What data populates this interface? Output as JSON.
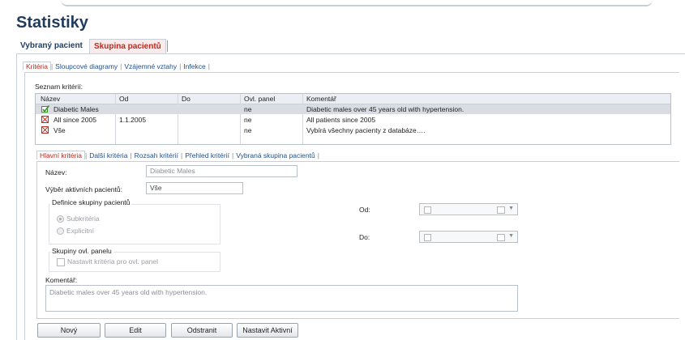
{
  "page_title": "Statistiky",
  "main_tabs": [
    "Vybraný pacient",
    "Skupina pacientů"
  ],
  "sub_tabs": [
    "Kritéria",
    "Sloupcové diagramy",
    "Vzájemné vztahy",
    "Infekce"
  ],
  "criteria_list_label": "Seznam kritérií:",
  "columns": [
    "Název",
    "Od",
    "Do",
    "Ovl. panel",
    "Komentář"
  ],
  "rows": [
    {
      "icon": "check-icon",
      "name": "Diabetic Males",
      "from": "",
      "to": "",
      "panel": "ne",
      "comment": "Diabetic males over 45 years old with hypertension."
    },
    {
      "icon": "x-icon",
      "name": "All since 2005",
      "from": "1.1.2005",
      "to": "",
      "panel": "ne",
      "comment": "All patients since 2005"
    },
    {
      "icon": "x-icon",
      "name": "Vše",
      "from": "",
      "to": "",
      "panel": "ne",
      "comment": "Vybírá všechny pacienty z databáze…."
    }
  ],
  "detail_tabs": [
    "Hlavní kritéria",
    "Další kritéria",
    "Rozsah kritérií",
    "Přehled kritérií",
    "Vybraná skupina pacientů"
  ],
  "form": {
    "name_label": "Název:",
    "name_value": "Diabetic Males",
    "active_label": "Výběr aktivních pacientů:",
    "active_value": "Vše",
    "group_def_label": "Definice skupiny pacientů",
    "radio_sub": "Subkritéria",
    "radio_explicit": "Explicitní",
    "panel_groups_label": "Skupiny ovl. panelu",
    "panel_checkbox": "Nastavit kritéria pro ovl. panel",
    "from_label": "Od:",
    "to_label": "Do:",
    "comment_label": "Komentář:",
    "comment_value": "Diabetic males over 45 years old with hypertension."
  },
  "buttons": [
    "Nový",
    "Edit",
    "Odstranit",
    "Nastavit Aktivní"
  ],
  "colors": {
    "title": "#1f3c5f",
    "active_tab": "#c0281d",
    "tab_link": "#1f4f88",
    "selected_row": "#d9dde3",
    "check": "#3f8f2a"
  }
}
